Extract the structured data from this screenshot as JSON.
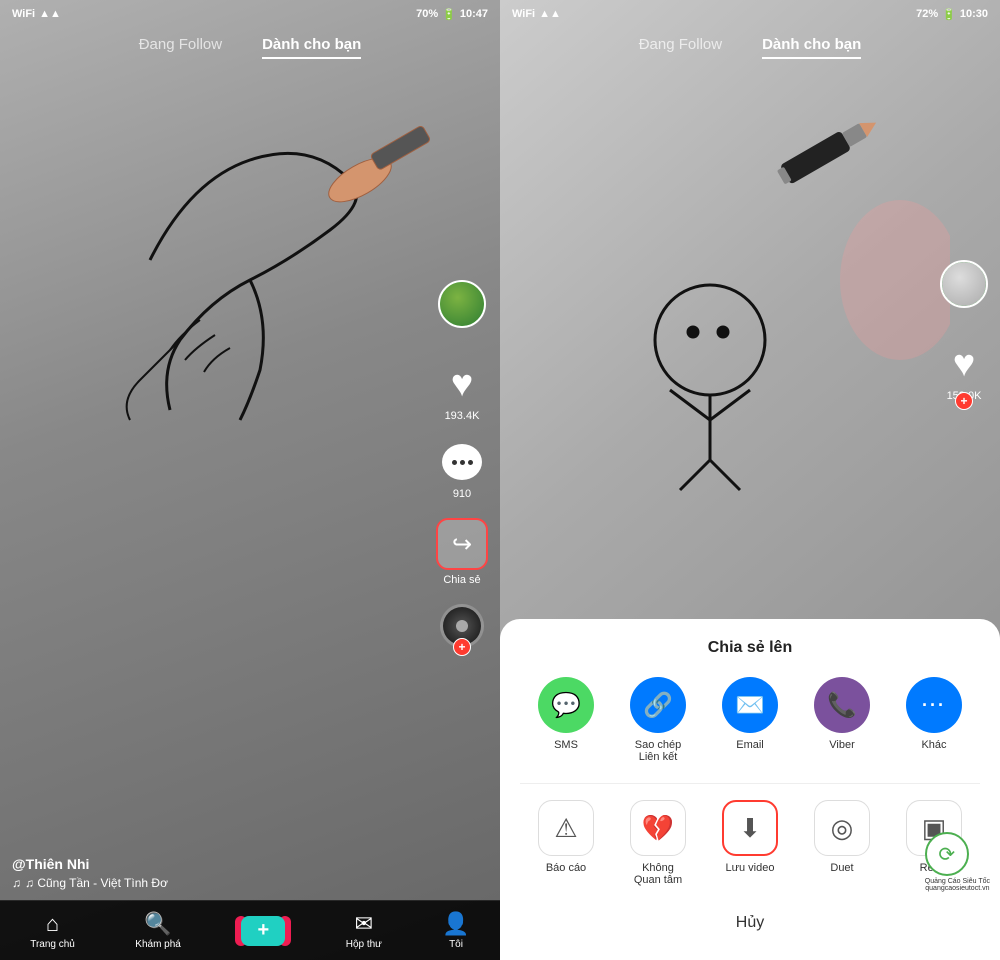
{
  "left_phone": {
    "status": {
      "wifi": "WiFi",
      "signal": "📶",
      "battery": "70%",
      "time": "10:47"
    },
    "tabs": {
      "following": "Đang Follow",
      "for_you": "Dành cho bạn"
    },
    "active_tab": "for_you",
    "actions": {
      "likes": "193.4K",
      "comments": "910",
      "share_label": "Chia sẻ"
    },
    "bottom_info": {
      "username": "@Thiên Nhi",
      "song": "♫ Cũng Tần - Việt  Tình Đơ"
    },
    "nav": {
      "home": "Trang chủ",
      "explore": "Khám phá",
      "add": "+",
      "inbox": "Hộp thư",
      "profile": "Tôi"
    }
  },
  "right_phone": {
    "status": {
      "wifi": "WiFi",
      "signal": "📶",
      "battery": "72%",
      "time": "10:30"
    },
    "tabs": {
      "following": "Đang Follow",
      "for_you": "Dành cho bạn"
    },
    "active_tab": "for_you",
    "actions": {
      "likes": "158.0K"
    },
    "share_sheet": {
      "title": "Chia sẻ lên",
      "row1": [
        {
          "id": "sms",
          "label": "SMS",
          "color": "#4CD964",
          "icon": "💬"
        },
        {
          "id": "copy_link",
          "label": "Sao chép\nLiên kết",
          "color": "#007AFF",
          "icon": "🔗"
        },
        {
          "id": "email",
          "label": "Email",
          "color": "#007AFF",
          "icon": "✉️"
        },
        {
          "id": "viber",
          "label": "Viber",
          "color": "#7B519D",
          "icon": "📞"
        },
        {
          "id": "more",
          "label": "Khác",
          "color": "#007AFF",
          "icon": "···"
        }
      ],
      "row2": [
        {
          "id": "report",
          "label": "Báo cáo",
          "icon": "⚠",
          "highlighted": false
        },
        {
          "id": "not_interested",
          "label": "Không\nQuan tâm",
          "icon": "💔",
          "highlighted": false
        },
        {
          "id": "save_video",
          "label": "Lưu video",
          "icon": "⬇",
          "highlighted": true
        },
        {
          "id": "duet",
          "label": "Duet",
          "icon": "◎",
          "highlighted": false
        },
        {
          "id": "react",
          "label": "React",
          "icon": "▣",
          "highlighted": false
        }
      ],
      "cancel": "Hủy"
    }
  }
}
